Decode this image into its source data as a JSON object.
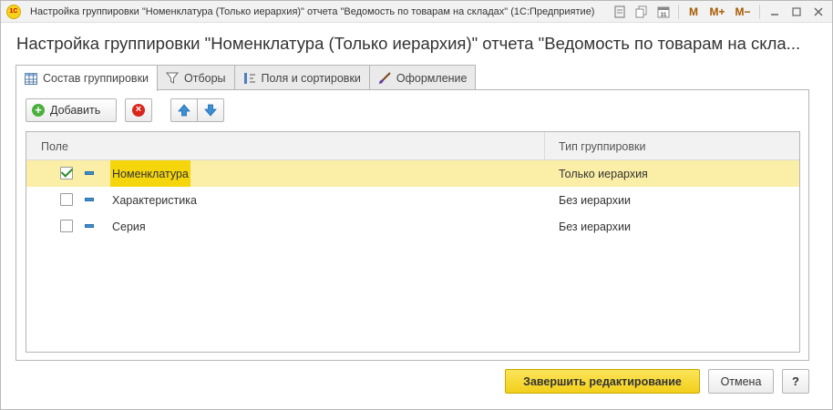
{
  "window": {
    "logo": "1С",
    "title": "Настройка группировки \"Номенклатура (Только иерархия)\" отчета \"Ведомость по товарам на складах\"  (1С:Предприятие)",
    "tools": {
      "m": "M",
      "m_plus": "M+",
      "m_minus": "M−"
    }
  },
  "header": {
    "title": "Настройка группировки \"Номенклатура (Только иерархия)\" отчета \"Ведомость по товарам на скла..."
  },
  "tabs": [
    {
      "label": "Состав группировки",
      "icon": "table-icon",
      "active": true
    },
    {
      "label": "Отборы",
      "icon": "filter-icon",
      "active": false
    },
    {
      "label": "Поля и сортировки",
      "icon": "sort-icon",
      "active": false
    },
    {
      "label": "Оформление",
      "icon": "brush-icon",
      "active": false
    }
  ],
  "toolbar": {
    "add_label": "Добавить"
  },
  "table": {
    "columns": [
      "Поле",
      "Тип группировки"
    ],
    "rows": [
      {
        "checked": true,
        "name": "Номенклатура",
        "type": "Только иерархия",
        "selected": true
      },
      {
        "checked": false,
        "name": "Характеристика",
        "type": "Без иерархии",
        "selected": false
      },
      {
        "checked": false,
        "name": "Серия",
        "type": "Без иерархии",
        "selected": false
      }
    ]
  },
  "footer": {
    "finish_label": "Завершить редактирование",
    "cancel_label": "Отмена",
    "help_label": "?"
  },
  "colors": {
    "selected_row": "#fbeea6",
    "selected_cell": "#f5d60c",
    "primary_button": "#f3cf1a"
  }
}
